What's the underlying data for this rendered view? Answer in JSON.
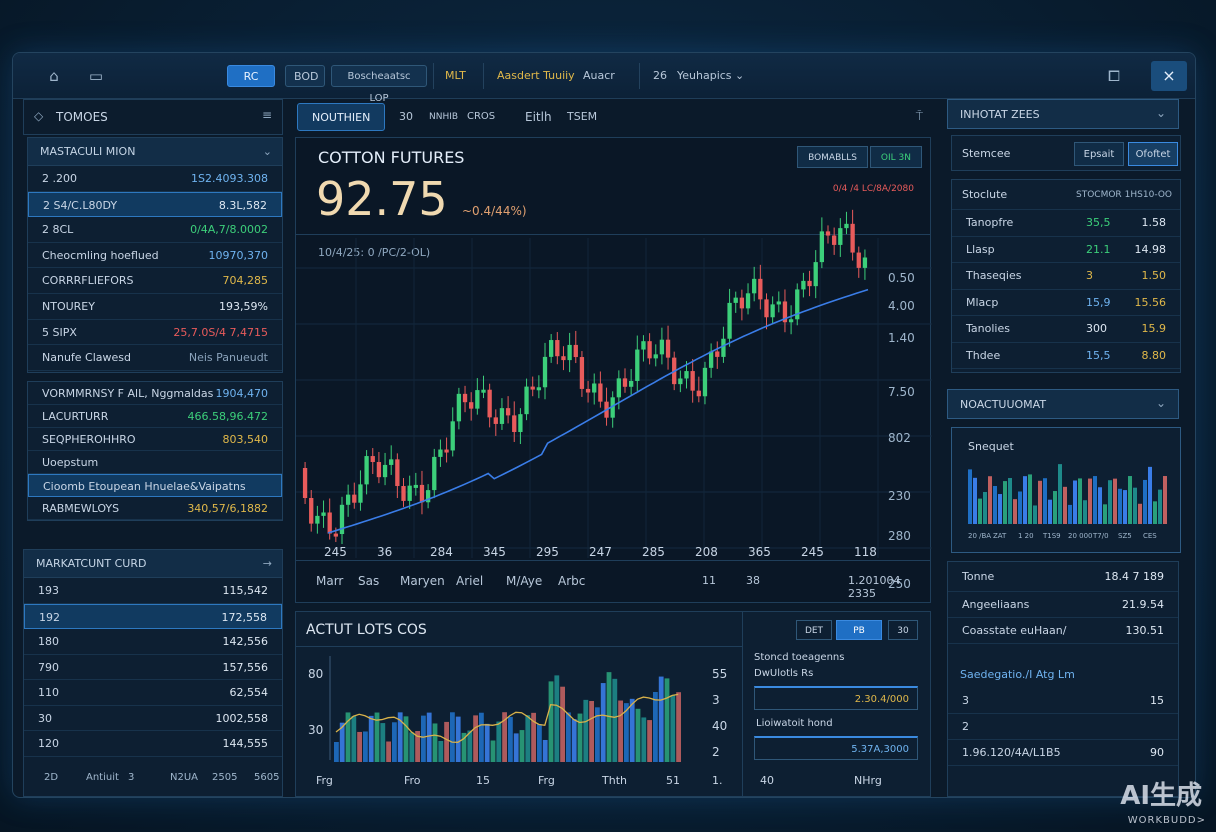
{
  "topbar": {
    "home_icon": "home-icon",
    "window_icon": "window-icon",
    "btn1": "RC",
    "btn2": "BOD",
    "btn3": "Boscheaatsc LOP",
    "mlt": "MLT",
    "feed": "Aasdert Tuuiiy",
    "author": "Auacr",
    "count": "26",
    "menu": "Yeuhapics",
    "maximize_icon": "maximize-icon",
    "close_icon": "×"
  },
  "left": {
    "title": "TOMOES",
    "section1": "MASTACULI MION",
    "rows1": [
      {
        "label": "2 .200",
        "value": "1S2.4093.308",
        "color": "b"
      },
      {
        "label": "2  S4/C.L80DY",
        "value": "8.3L,582",
        "color": "w",
        "selected": true
      },
      {
        "label": "2  8CL",
        "value": "0/4A,7/8.0002",
        "color": "g"
      },
      {
        "label": "Cheocmling hoeflued",
        "value": "10970,370",
        "color": "b"
      },
      {
        "label": "CORRRFLIEFORS",
        "value": "704,285",
        "color": "y"
      },
      {
        "label": "NTOUREY",
        "value": "193,59%",
        "color": "w"
      },
      {
        "label": "5  SIPX",
        "value": "25,7.0S/4 7,4715",
        "color": "rd"
      },
      {
        "label": "Nanufe Clawesd",
        "value": "Neis    Panueudt",
        "color": "m"
      }
    ],
    "rows2": [
      {
        "label": "VORMMRNSY F AlL, Nggmaldas",
        "value": "1904,470",
        "color": "b"
      },
      {
        "label": "LACURTURR",
        "value": "466.58,96.472",
        "color": "g"
      },
      {
        "label": "SEQPHEROHHRO",
        "value": "803,540",
        "color": "y"
      },
      {
        "label": "Uoepstum",
        "value": "",
        "color": "m"
      },
      {
        "label": "Cioomb Etoupean Hnuelae&Vaipatns",
        "value": "",
        "color": "w",
        "selected": true
      },
      {
        "label": "RABMEWLOYS",
        "value": "340,57/6,1882",
        "color": "y"
      }
    ],
    "section2": "MARKATCUNT CURD",
    "rows3": [
      {
        "label": "193",
        "value": "115,542"
      },
      {
        "label": "192",
        "value": "172,558",
        "selected": true
      },
      {
        "label": "180",
        "value": "142,556"
      },
      {
        "label": "790",
        "value": "157,556"
      },
      {
        "label": "110",
        "value": "62,554"
      },
      {
        "label": "30",
        "value": "1002,558"
      },
      {
        "label": "120",
        "value": "144,555"
      }
    ],
    "footer": [
      "2D",
      "Antiuit",
      "3",
      "N2UA",
      "2505",
      "5605"
    ]
  },
  "center": {
    "tabs": [
      "NOUTHIEN",
      "30",
      "NNHIB",
      "CROS",
      "Eitlh",
      "TSEM"
    ],
    "title": "COTTON FUTURES",
    "price": "92.75",
    "change": "~0.4/44%)",
    "btn_a": "BOMABLLS",
    "btn_b": "OIL 3N",
    "top_right_note": "0/4 /4 LC/8A/2080",
    "sub_note": "10/4/25:    0 /PC/2-OL)",
    "x_ticks": [
      "245",
      "36",
      "284",
      "345",
      "295",
      "247",
      "285",
      "208",
      "365",
      "245",
      "118"
    ],
    "y_ticks": [
      "0.50",
      "4.00",
      "1.40",
      "7.50",
      "802",
      "230",
      "280",
      "250"
    ],
    "months": [
      "Marr",
      "Sas",
      "Maryen",
      "Ariel",
      "M/Aye",
      "Arbc"
    ],
    "month_right": [
      "11",
      "38",
      "1.201004 2335"
    ],
    "bottom_title": "ACTUT LOTS COS",
    "bottom_btns": [
      "DET",
      "PB",
      "30"
    ],
    "bottom_y": [
      "80",
      "30"
    ],
    "bottom_y_right": [
      "55",
      "3",
      "40",
      "2"
    ],
    "bottom_x": [
      "Frg",
      "Fro",
      "15",
      "Frg",
      "Thth",
      "51",
      "1.",
      "40",
      "NHrg"
    ],
    "side_box": {
      "label1": "Stoncd toeagenns",
      "label2": "DwUlotls Rs",
      "value1": "2.30.4/000",
      "label3": "Lioiwatoit hond",
      "value2": "5.37A,3000"
    }
  },
  "right": {
    "title": "INHOTAT ZEES",
    "sub_label": "Stemcee",
    "btn_a": "Epsait",
    "btn_b": "Ofoftet",
    "table_head": [
      "Stoclute",
      "STOCMOR",
      "1HS10-OO"
    ],
    "rows": [
      {
        "label": "Tanopfre",
        "a": "35,5",
        "b": "1.58",
        "ca": "g",
        "cb": "w"
      },
      {
        "label": "Llasp",
        "a": "21.1",
        "b": "14.98",
        "ca": "g",
        "cb": "w"
      },
      {
        "label": "Thaseqies",
        "a": "3",
        "b": "1.50",
        "ca": "y",
        "cb": "y"
      },
      {
        "label": "Mlacp",
        "a": "15,9",
        "b": "15.56",
        "ca": "b",
        "cb": "y"
      },
      {
        "label": "Tanolies",
        "a": "300",
        "b": "15.9",
        "ca": "w",
        "cb": "y"
      },
      {
        "label": "Thdee",
        "a": "15,5",
        "b": "8.80",
        "ca": "b",
        "cb": "y"
      }
    ],
    "section2": "NOACTUUOMAT",
    "chart_label": "Snequet",
    "chart_x": [
      "20 /BA",
      "ZAT",
      "1 20",
      "T1S9",
      "20 000",
      "T7/0",
      "SZ5",
      "CES"
    ],
    "section3_rows": [
      {
        "label": "Tonne",
        "value": "18.4 7 189"
      },
      {
        "label": "Angeeliaans",
        "value": "21.9.54"
      },
      {
        "label": "Coasstate euHaan/",
        "value": "130.51"
      }
    ],
    "section4": "Saedegatio./I Atg Lm",
    "list": [
      {
        "label": "3",
        "value": "15"
      },
      {
        "label": "2",
        "value": ""
      },
      {
        "label": "1.96.120/4A/L1B5",
        "value": "90"
      }
    ]
  },
  "watermark": {
    "line1": "AI生成",
    "line2": "WORKBUDD>"
  },
  "colors": {
    "up": "#3ccf7a",
    "down": "#e85b5b",
    "accent": "#2d78c0",
    "ma": "#3a7de8"
  }
}
